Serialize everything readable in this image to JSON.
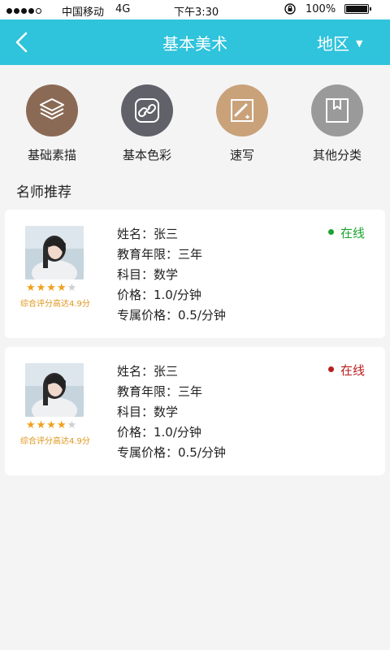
{
  "status_bar": {
    "carrier": "中国移动",
    "network": "4G",
    "time": "下午3:30",
    "battery": "100%"
  },
  "nav": {
    "title": "基本美术",
    "region": "地区",
    "accent_color": "#2fc3dc"
  },
  "categories": [
    {
      "label": "基础素描",
      "icon": "layers-icon",
      "color": "#8b6a55"
    },
    {
      "label": "基本色彩",
      "icon": "link-icon",
      "color": "#616169"
    },
    {
      "label": "速写",
      "icon": "sketch-brush-icon",
      "color": "#c9a27a"
    },
    {
      "label": "其他分类",
      "icon": "bookmark-icon",
      "color": "#9a9a9a"
    }
  ],
  "section": {
    "title": "名师推荐"
  },
  "teachers": [
    {
      "name": "姓名：张三",
      "years": "教育年限：三年",
      "subject": "科目：数学",
      "price": "价格：1.0/分钟",
      "exclusive_price": "专属价格：0.5/分钟",
      "status": "在线",
      "status_color": "#1aa52c",
      "stars": "★★★★",
      "stars_off": "★",
      "rating": 4,
      "rating_text": "综合评分高达4.9分"
    },
    {
      "name": "姓名：张三",
      "years": "教育年限：三年",
      "subject": "科目：数学",
      "price": "价格：1.0/分钟",
      "exclusive_price": "专属价格：0.5/分钟",
      "status": "在线",
      "status_color": "#b81e1e",
      "stars": "★★★★",
      "stars_off": "★",
      "rating": 4,
      "rating_text": "综合评分高达4.9分"
    }
  ]
}
